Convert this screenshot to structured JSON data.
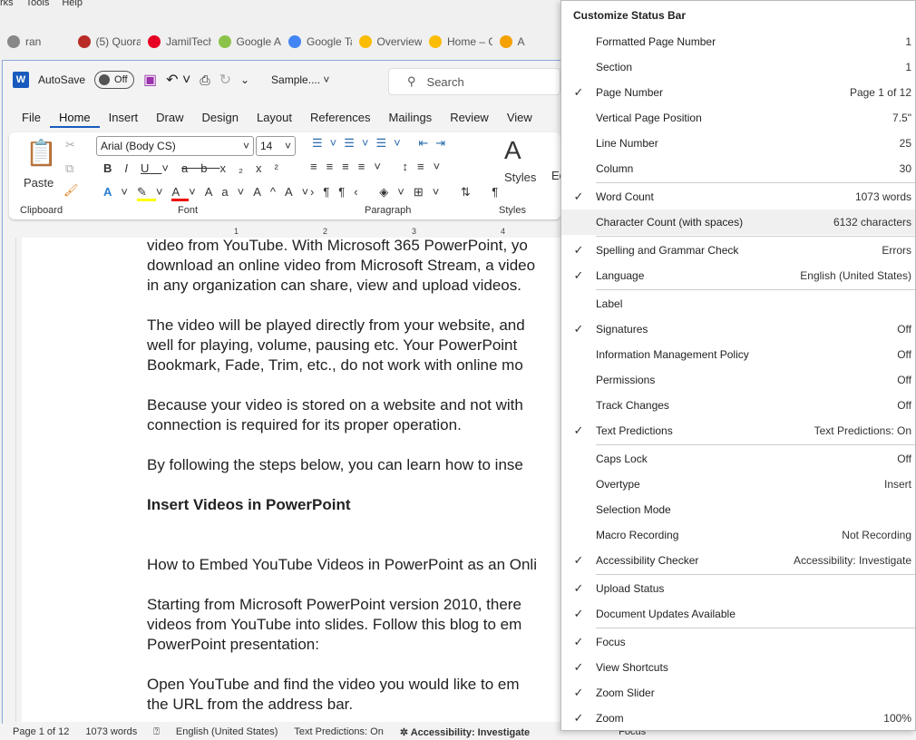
{
  "browser": {
    "menu": [
      "rks",
      "Tools",
      "Help"
    ],
    "tabs": [
      {
        "label": "ran",
        "color": "#888"
      },
      {
        "label": "(5) Quora",
        "color": "#b92b27"
      },
      {
        "label": "JamilTech",
        "color": "#e60023"
      },
      {
        "label": "Google Ads",
        "color": "#8bc34a"
      },
      {
        "label": "Google Tag",
        "color": "#4285f4"
      },
      {
        "label": "Overview",
        "color": "#fbbc04"
      },
      {
        "label": "Home – G",
        "color": "#fbbc04"
      },
      {
        "label": "A",
        "color": "#f4a100"
      }
    ]
  },
  "word": {
    "autosave": "AutoSave",
    "toggle": "Off",
    "doc_name": "Sample....",
    "search": "Search",
    "ribbon_tabs": [
      "File",
      "Home",
      "Insert",
      "Draw",
      "Design",
      "Layout",
      "References",
      "Mailings",
      "Review",
      "View"
    ],
    "font_name": "Arial (Body CS)",
    "font_size": "14",
    "paste": "Paste",
    "styles": "Styles",
    "editing": "Ed",
    "groups": {
      "clipboard": "Clipboard",
      "font": "Font",
      "paragraph": "Paragraph",
      "styles": "Styles"
    },
    "ruler": [
      "1",
      "2",
      "3",
      "4"
    ],
    "document": [
      [
        "video from YouTube. With Microsoft 365 PowerPoint, yo",
        "download an online video from Microsoft Stream, a video",
        "in any organization can share, view and upload videos."
      ],
      [
        "The video will be played directly from your website, and",
        "well for playing, volume, pausing etc. Your PowerPoint",
        "Bookmark, Fade, Trim, etc., do not work with online mo"
      ],
      [
        "Because your video is stored on a website and not with",
        "connection is required for its proper operation."
      ],
      [
        "By following the steps below, you can learn how to inse"
      ]
    ],
    "heading": "Insert Videos in PowerPoint",
    "document2": [
      [
        "How to Embed YouTube Videos in PowerPoint as an Onli"
      ],
      [
        "Starting from Microsoft PowerPoint version 2010, there",
        "videos from YouTube into slides. Follow this blog to em",
        "PowerPoint presentation:"
      ],
      [
        "Open YouTube and find the video you would like to em",
        "the URL from the address bar."
      ]
    ]
  },
  "status": {
    "page": "Page 1 of 12",
    "words": "1073 words",
    "language": "English (United States)",
    "predictions": "Text Predictions: On",
    "accessibility": "Accessibility: Investigate",
    "focus": "Focus"
  },
  "context_menu": {
    "title": "Customize Status Bar",
    "groups": [
      [
        {
          "label": "Formatted Page Number",
          "value": "1",
          "checked": false
        },
        {
          "label": "Section",
          "value": "1",
          "checked": false
        },
        {
          "label": "Page Number",
          "value": "Page 1 of 12",
          "checked": true
        },
        {
          "label": "Vertical Page Position",
          "value": "7.5\"",
          "checked": false
        },
        {
          "label": "Line Number",
          "value": "25",
          "checked": false
        },
        {
          "label": "Column",
          "value": "30",
          "checked": false
        }
      ],
      [
        {
          "label": "Word Count",
          "value": "1073 words",
          "checked": true
        },
        {
          "label": "Character Count (with spaces)",
          "value": "6132 characters",
          "checked": false,
          "highlighted": true
        }
      ],
      [
        {
          "label": "Spelling and Grammar Check",
          "value": "Errors",
          "checked": true
        },
        {
          "label": "Language",
          "value": "English (United States)",
          "checked": true
        }
      ],
      [
        {
          "label": "Label",
          "value": "",
          "checked": false
        },
        {
          "label": "Signatures",
          "value": "Off",
          "checked": true
        },
        {
          "label": "Information Management Policy",
          "value": "Off",
          "checked": false
        },
        {
          "label": "Permissions",
          "value": "Off",
          "checked": false
        },
        {
          "label": "Track Changes",
          "value": "Off",
          "checked": false
        },
        {
          "label": "Text Predictions",
          "value": "Text Predictions: On",
          "checked": true
        }
      ],
      [
        {
          "label": "Caps Lock",
          "value": "Off",
          "checked": false
        },
        {
          "label": "Overtype",
          "value": "Insert",
          "checked": false
        },
        {
          "label": "Selection Mode",
          "value": "",
          "checked": false
        },
        {
          "label": "Macro Recording",
          "value": "Not Recording",
          "checked": false
        },
        {
          "label": "Accessibility Checker",
          "value": "Accessibility: Investigate",
          "checked": true
        }
      ],
      [
        {
          "label": "Upload Status",
          "value": "",
          "checked": true
        },
        {
          "label": "Document Updates Available",
          "value": "",
          "checked": true
        }
      ],
      [
        {
          "label": "Focus",
          "value": "",
          "checked": true
        },
        {
          "label": "View Shortcuts",
          "value": "",
          "checked": true
        },
        {
          "label": "Zoom Slider",
          "value": "",
          "checked": true
        },
        {
          "label": "Zoom",
          "value": "100%",
          "checked": true
        }
      ]
    ]
  },
  "check_glyph": "✓"
}
